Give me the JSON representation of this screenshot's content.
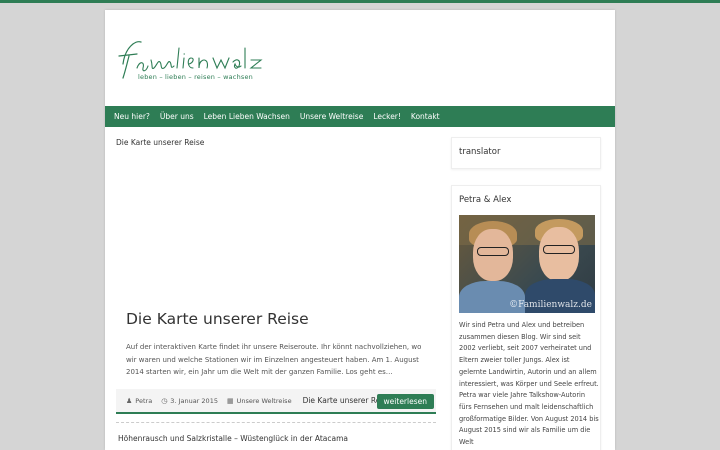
{
  "colors": {
    "accent": "#2e7d55",
    "background": "#d5d5d5",
    "page": "#ffffff"
  },
  "header": {
    "logo_text": "familienwalz",
    "tagline": "leben – lieben – reisen – wachsen"
  },
  "nav": {
    "items": [
      {
        "label": "Neu hier?"
      },
      {
        "label": "Über uns"
      },
      {
        "label": "Leben Lieben Wachsen"
      },
      {
        "label": "Unsere Weltreise"
      },
      {
        "label": "Lecker!"
      },
      {
        "label": "Kontakt"
      }
    ]
  },
  "main": {
    "breadcrumb": "Die Karte unserer Reise",
    "post": {
      "title": "Die Karte unserer Reise",
      "excerpt": "Auf der interaktiven Karte findet ihr unsere Reiseroute. Ihr könnt nachvollziehen, wo wir waren und welche Stationen wir im Einzelnen angesteuert haben. Am 1. August 2014 starten wir, ein Jahr um die Welt mit der ganzen Familie. Los geht es…",
      "author": "Petra",
      "date": "3. Januar 2015",
      "category": "Unsere Weltreise",
      "link_title": "Die Karte unserer Reise",
      "read_more": "weiterlesen"
    },
    "next_post_title": "Höhenrausch und Salzkristalle – Wüstenglück in der Atacama"
  },
  "sidebar": {
    "translator_title": "translator",
    "about": {
      "title": "Petra & Alex",
      "photo_watermark": "©Familienwalz.de",
      "text": "Wir sind Petra und Alex und betreiben zusammen diesen Blog. Wir sind seit 2002 verliebt, seit 2007 verheiratet und Eltern zweier toller Jungs. Alex ist gelernte Landwirtin, Autorin und an allem interessiert, was Körper und Seele erfreut. Petra war viele Jahre Talkshow-Autorin fürs Fernsehen und malt leidenschaftlich großformatige Bilder. Von August 2014 bis August 2015 sind wir als Familie um die Welt"
    }
  }
}
